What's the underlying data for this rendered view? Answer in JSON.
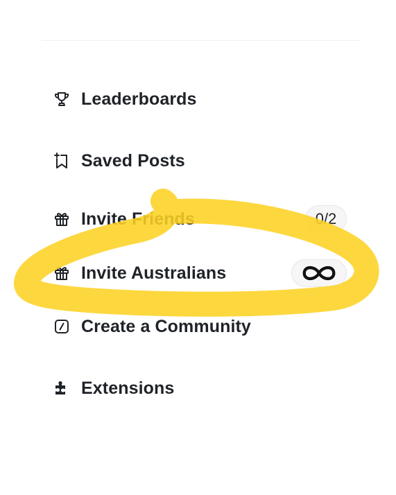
{
  "menu": {
    "items": [
      {
        "label": "Leaderboards",
        "icon": "trophy-icon"
      },
      {
        "label": "Saved Posts",
        "icon": "bookmark-add-icon"
      },
      {
        "label": "Invite Friends",
        "icon": "gift-icon",
        "badge": "0/2"
      },
      {
        "label": "Invite Australians",
        "icon": "gift-icon",
        "badge_icon": "infinity-icon"
      },
      {
        "label": "Create a Community",
        "icon": "slash-square-icon"
      },
      {
        "label": "Extensions",
        "icon": "puzzle-icon"
      }
    ]
  },
  "highlight": {
    "color": "#fdd123"
  },
  "colors": {
    "text": "#1f2328",
    "pill_bg": "#f6f6f6",
    "pill_border": "#e6e6e6"
  }
}
